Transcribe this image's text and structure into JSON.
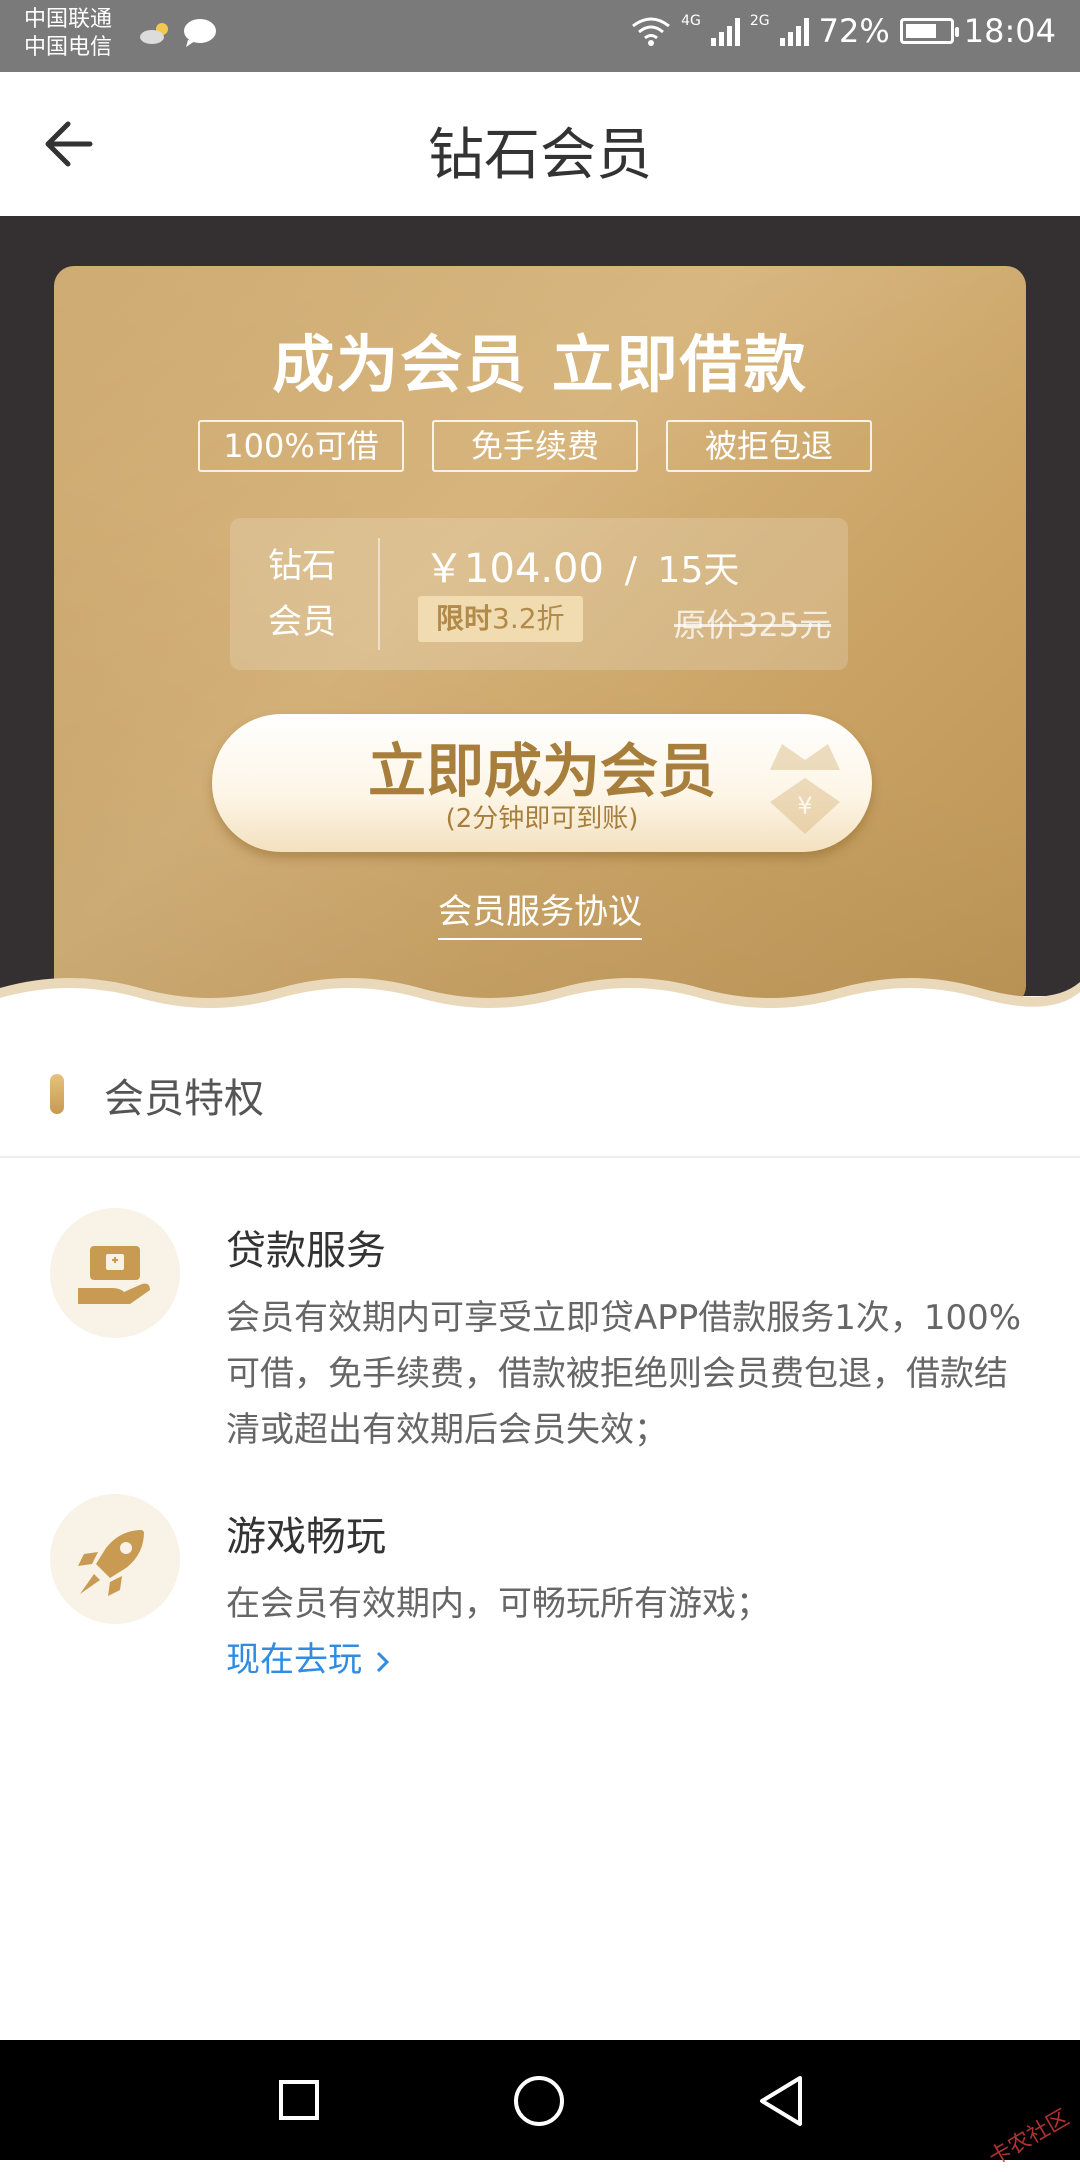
{
  "status_bar": {
    "carrier_1": "中国联通",
    "carrier_2": "中国电信",
    "network_1": "4G",
    "network_2": "2G",
    "battery": "72%",
    "battery_level": 0.72,
    "time": "18:04"
  },
  "header": {
    "title": "钻石会员",
    "back_icon": "arrow-left-icon"
  },
  "card": {
    "title": "成为会员 立即借款",
    "tags": [
      "100%可借",
      "免手续费",
      "被拒包退"
    ],
    "tier_label_line1": "钻石",
    "tier_label_line2": "会员",
    "price": "￥104.00",
    "price_separator": "/",
    "duration": "15天",
    "limit_label": "限时",
    "discount": "3.2折",
    "original_price": "原价325元",
    "cta_main": "立即成为会员",
    "cta_sub": "(2分钟即可到账)",
    "cta_icon": "crown-yuan-icon",
    "agreement_link": "会员服务协议"
  },
  "privileges": {
    "section_title": "会员特权",
    "items": [
      {
        "icon": "loan-hand-icon",
        "title": "贷款服务",
        "desc": "会员有效期内可享受立即贷APP借款服务1次，100%可借，免手续费，借款被拒绝则会员费包退，借款结清或超出有效期后会员失效；"
      },
      {
        "icon": "rocket-icon",
        "title": "游戏畅玩",
        "desc": "在会员有效期内，可畅玩所有游戏；",
        "link": "现在去玩"
      }
    ]
  },
  "nav_bar": {
    "recent_icon": "square-icon",
    "home_icon": "circle-icon",
    "back_icon": "triangle-back-icon"
  },
  "watermark": "卡农社区",
  "colors": {
    "gold": "#c9a264",
    "gold_text": "#a87e3c",
    "link_blue": "#2f8ce0",
    "dark_bg": "#343031"
  }
}
